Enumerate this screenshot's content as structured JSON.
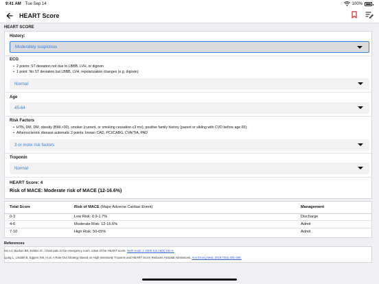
{
  "status_bar": {
    "time": "9:41 AM",
    "date": "Tue Sep 14",
    "battery": "100%"
  },
  "nav": {
    "title": "HEART Score"
  },
  "section_title": "HEART SCORE",
  "history": {
    "label": "History:",
    "value": "Moderately suspicious"
  },
  "ecg": {
    "label": "ECG",
    "bullets": [
      "2 points: ST deviation not due to LBBB, LVH, or digoxin",
      "1 point: No ST deviation but LBBB, LVH, repolarization changes (e.g. digoxin)"
    ],
    "value": "Normal"
  },
  "age": {
    "label": "Age",
    "value": "45-64"
  },
  "risk_factors": {
    "label": "Risk Factors",
    "bullets": [
      "HTN, DM, DM, obesity (BMI >30), smoker (current, or smoking cessation ≤3 mo), positive family history (parent or sibling with CVD before age 65);",
      "Atherosclerotic disease automatic 2 points: known CAD, PCI/CABG, CVA/TIA, PAD"
    ],
    "value": "3 or more risk factors"
  },
  "troponin": {
    "label": "Troponin",
    "value": "Normal"
  },
  "result": {
    "score": "HEART Score: 4",
    "risk": "Risk of MACE: Moderate risk of MACE (12-16.6%)"
  },
  "table": {
    "headers": {
      "score": "Total Score",
      "risk_bold": "Risk of MACE",
      "risk_rest": " (Major Adverse Cardiac Event)",
      "management": "Management"
    },
    "rows": [
      {
        "score": "0-3",
        "risk": "Low Risk: 0.9-1.7%",
        "management": "Discharge"
      },
      {
        "score": "4-6",
        "risk": "Moderate Risk: 12-16.6%",
        "management": "Admit"
      },
      {
        "score": "7-10",
        "risk": "High Risk: 50-65%",
        "management": "Admit"
      }
    ]
  },
  "references": {
    "title": "References",
    "items": [
      {
        "text": "Six AJ, Backus BE, Kelder JC. Chest pain in the emergency room: value of the HEART score. ",
        "link": "Neth Heart J. 2008 Jun;16(6):191-6."
      },
      {
        "text": "Ljung L, Lindahl B, Eggers KM, et al. A Rule-Out Strategy Based on High-Sensitivity Troponin and HEART Score Reduces Hospital Admissions. ",
        "link": "Ann Emerg Med. 2019;73(5):491-499."
      }
    ]
  },
  "colors": {
    "accent": "#2f7de0",
    "bookmark": "#e0242b"
  }
}
